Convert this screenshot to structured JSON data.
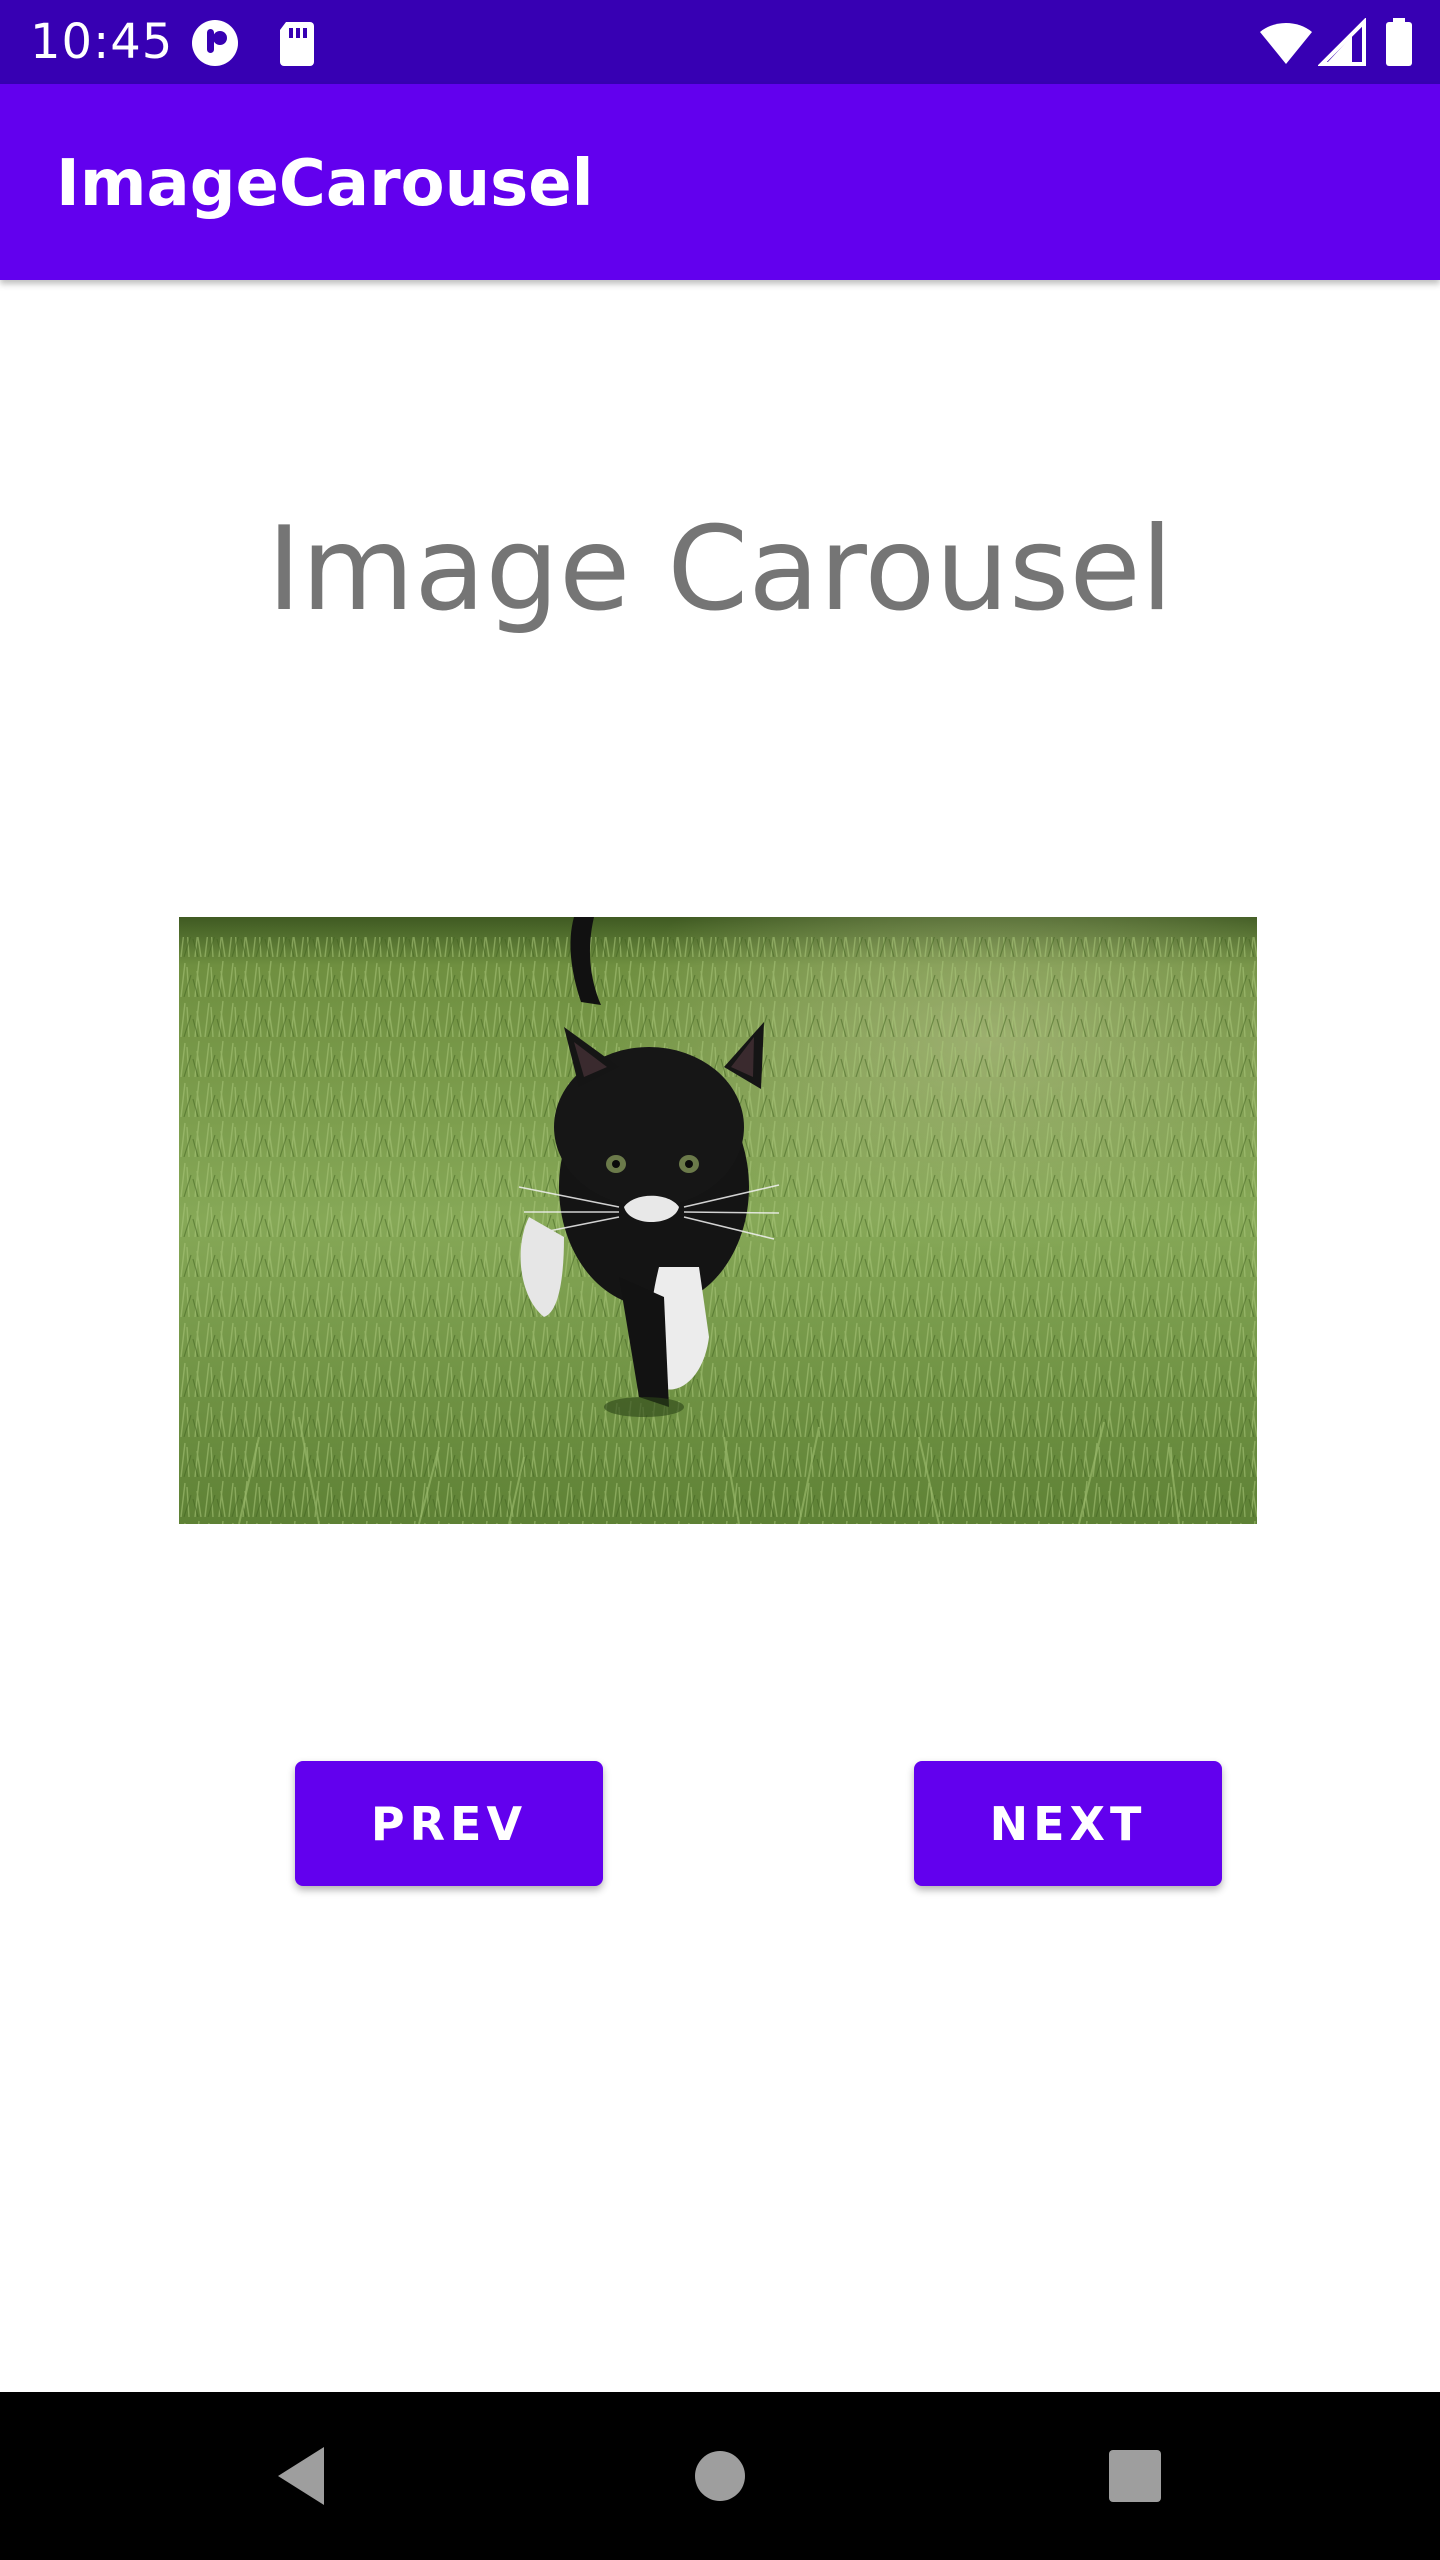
{
  "status_bar": {
    "time": "10:45",
    "icons": [
      "app-notification-icon",
      "sd-card-icon",
      "wifi-icon",
      "signal-icon",
      "battery-icon"
    ],
    "color": "#3700b3"
  },
  "app_bar": {
    "title": "ImageCarousel",
    "color": "#6200ee"
  },
  "main": {
    "heading": "Image Carousel",
    "image_subject": "black and white kitten walking on grass",
    "buttons": {
      "prev_label": "PREV",
      "next_label": "NEXT"
    },
    "accent_color": "#6200ee"
  },
  "nav_bar": {
    "icons": [
      "back-icon",
      "home-icon",
      "recents-icon"
    ]
  }
}
